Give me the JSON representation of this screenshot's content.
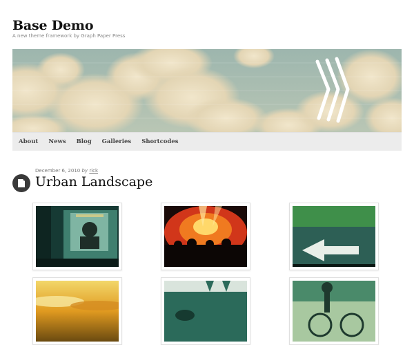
{
  "site": {
    "title": "Base Demo",
    "tagline": "A new theme framework by Graph Paper Press"
  },
  "nav": {
    "items": [
      "About",
      "News",
      "Blog",
      "Galleries",
      "Shortcodes"
    ]
  },
  "post": {
    "date": "December 6, 2010",
    "by": "by",
    "author": "rick",
    "title": "Urban Landscape",
    "icon": "document-icon"
  },
  "gallery": {
    "thumbnails": [
      {
        "name": "poster-wall",
        "accent": "#2f6a5e"
      },
      {
        "name": "concert-lights",
        "accent": "#e2401c"
      },
      {
        "name": "road-arrow",
        "accent": "#3d7f63"
      },
      {
        "name": "sunset-clouds",
        "accent": "#d9a21c"
      },
      {
        "name": "street-shadow",
        "accent": "#2a6b5c"
      },
      {
        "name": "bicycle-shadow",
        "accent": "#4a8a6a"
      }
    ]
  },
  "colors": {
    "nav_background": "#ececec",
    "sky": "#8fb0ab",
    "cloud": "#e8dcc0"
  }
}
